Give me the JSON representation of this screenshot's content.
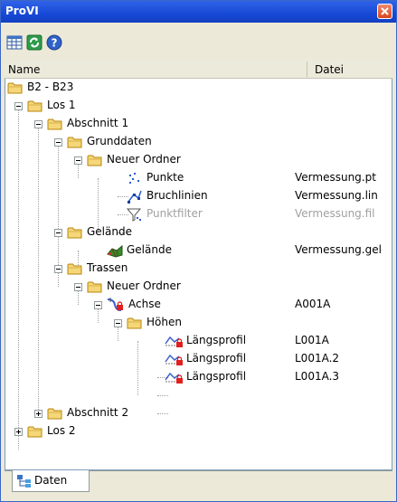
{
  "window": {
    "title": "ProVI"
  },
  "toolbar": {
    "buttons": [
      "table-icon",
      "refresh-icon",
      "help-icon"
    ]
  },
  "columns": {
    "name": "Name",
    "datei": "Datei"
  },
  "tree": {
    "root": {
      "label": "B2 - B23"
    },
    "los1": {
      "label": "Los 1"
    },
    "abschnitt1": {
      "label": "Abschnitt 1"
    },
    "grunddaten": {
      "label": "Grunddaten"
    },
    "neuer_ordner_1": {
      "label": "Neuer Ordner"
    },
    "punkte": {
      "label": "Punkte",
      "datei": "Vermessung.pt"
    },
    "bruchlinien": {
      "label": "Bruchlinien",
      "datei": "Vermessung.lin"
    },
    "punktfilter": {
      "label": "Punktfilter",
      "datei": "Vermessung.fil"
    },
    "gelaende_folder": {
      "label": "Gelände"
    },
    "gelaende_item": {
      "label": "Gelände",
      "datei": "Vermessung.gel"
    },
    "trassen": {
      "label": "Trassen"
    },
    "neuer_ordner_2": {
      "label": "Neuer Ordner"
    },
    "achse": {
      "label": "Achse",
      "datei": "A001A"
    },
    "hoehen": {
      "label": "Höhen"
    },
    "laengsprofil_1": {
      "label": "Längsprofil",
      "datei": "L001A"
    },
    "laengsprofil_2": {
      "label": "Längsprofil",
      "datei": "L001A.2"
    },
    "laengsprofil_3": {
      "label": "Längsprofil",
      "datei": "L001A.3"
    },
    "abschnitt2": {
      "label": "Abschnitt 2"
    },
    "los2": {
      "label": "Los 2"
    }
  },
  "tabs": {
    "daten": "Daten"
  },
  "colors": {
    "titlebar": "#1749d6",
    "folder": "#f5d77a",
    "disabled_text": "#a0a0a0"
  }
}
